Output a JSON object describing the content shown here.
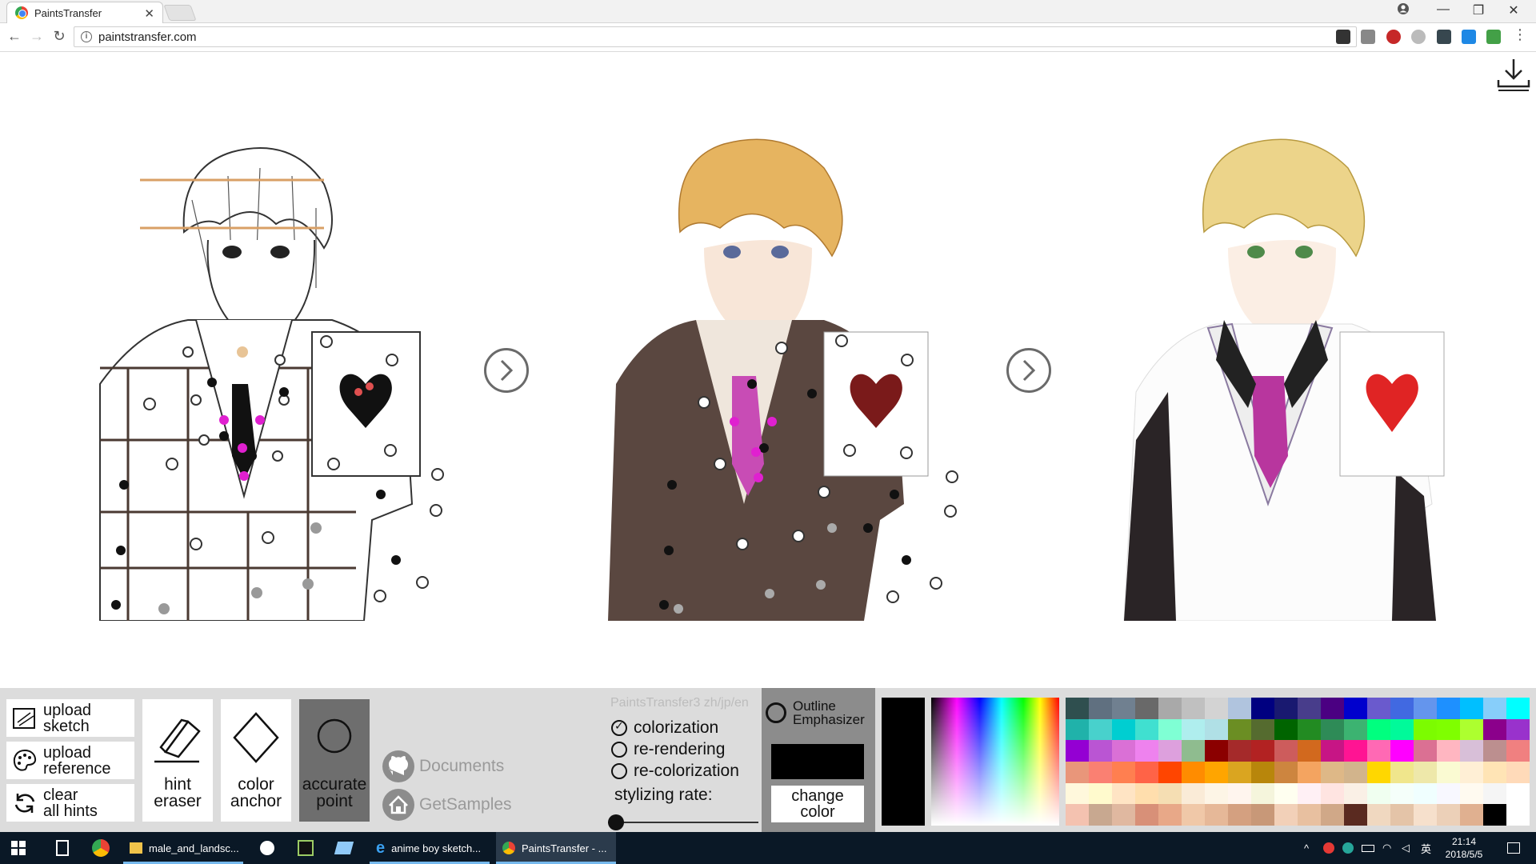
{
  "browser": {
    "tab_title": "PaintsTransfer",
    "url": "paintstransfer.com"
  },
  "page": {
    "brand": "PaintsTransfer3 zh/jp/en"
  },
  "controls": {
    "upload_sketch": "upload\nsketch",
    "upload_reference": "upload\nreference",
    "clear_hints": "clear\nall hints",
    "hint_eraser": "hint\neraser",
    "color_anchor": "color\nanchor",
    "accurate_point": "accurate\npoint",
    "documents": "Documents",
    "get_samples": "GetSamples",
    "modes": [
      {
        "label": "colorization",
        "selected": true
      },
      {
        "label": "re-rendering",
        "selected": false
      },
      {
        "label": "re-colorization",
        "selected": false
      }
    ],
    "stylizing_rate_label": "stylizing rate:",
    "stylizing_rate": 0,
    "outline_emphasizer": "Outline\nEmphasizer",
    "change_color": "change\ncolor",
    "current_color": "#000000"
  },
  "taskbar": {
    "items": [
      {
        "label": "male_and_landsc..."
      },
      {
        "label": "anime boy sketch..."
      },
      {
        "label": "PaintsTransfer - ..."
      }
    ],
    "time": "21:14",
    "date": "2018/5/5",
    "ime": "英"
  }
}
